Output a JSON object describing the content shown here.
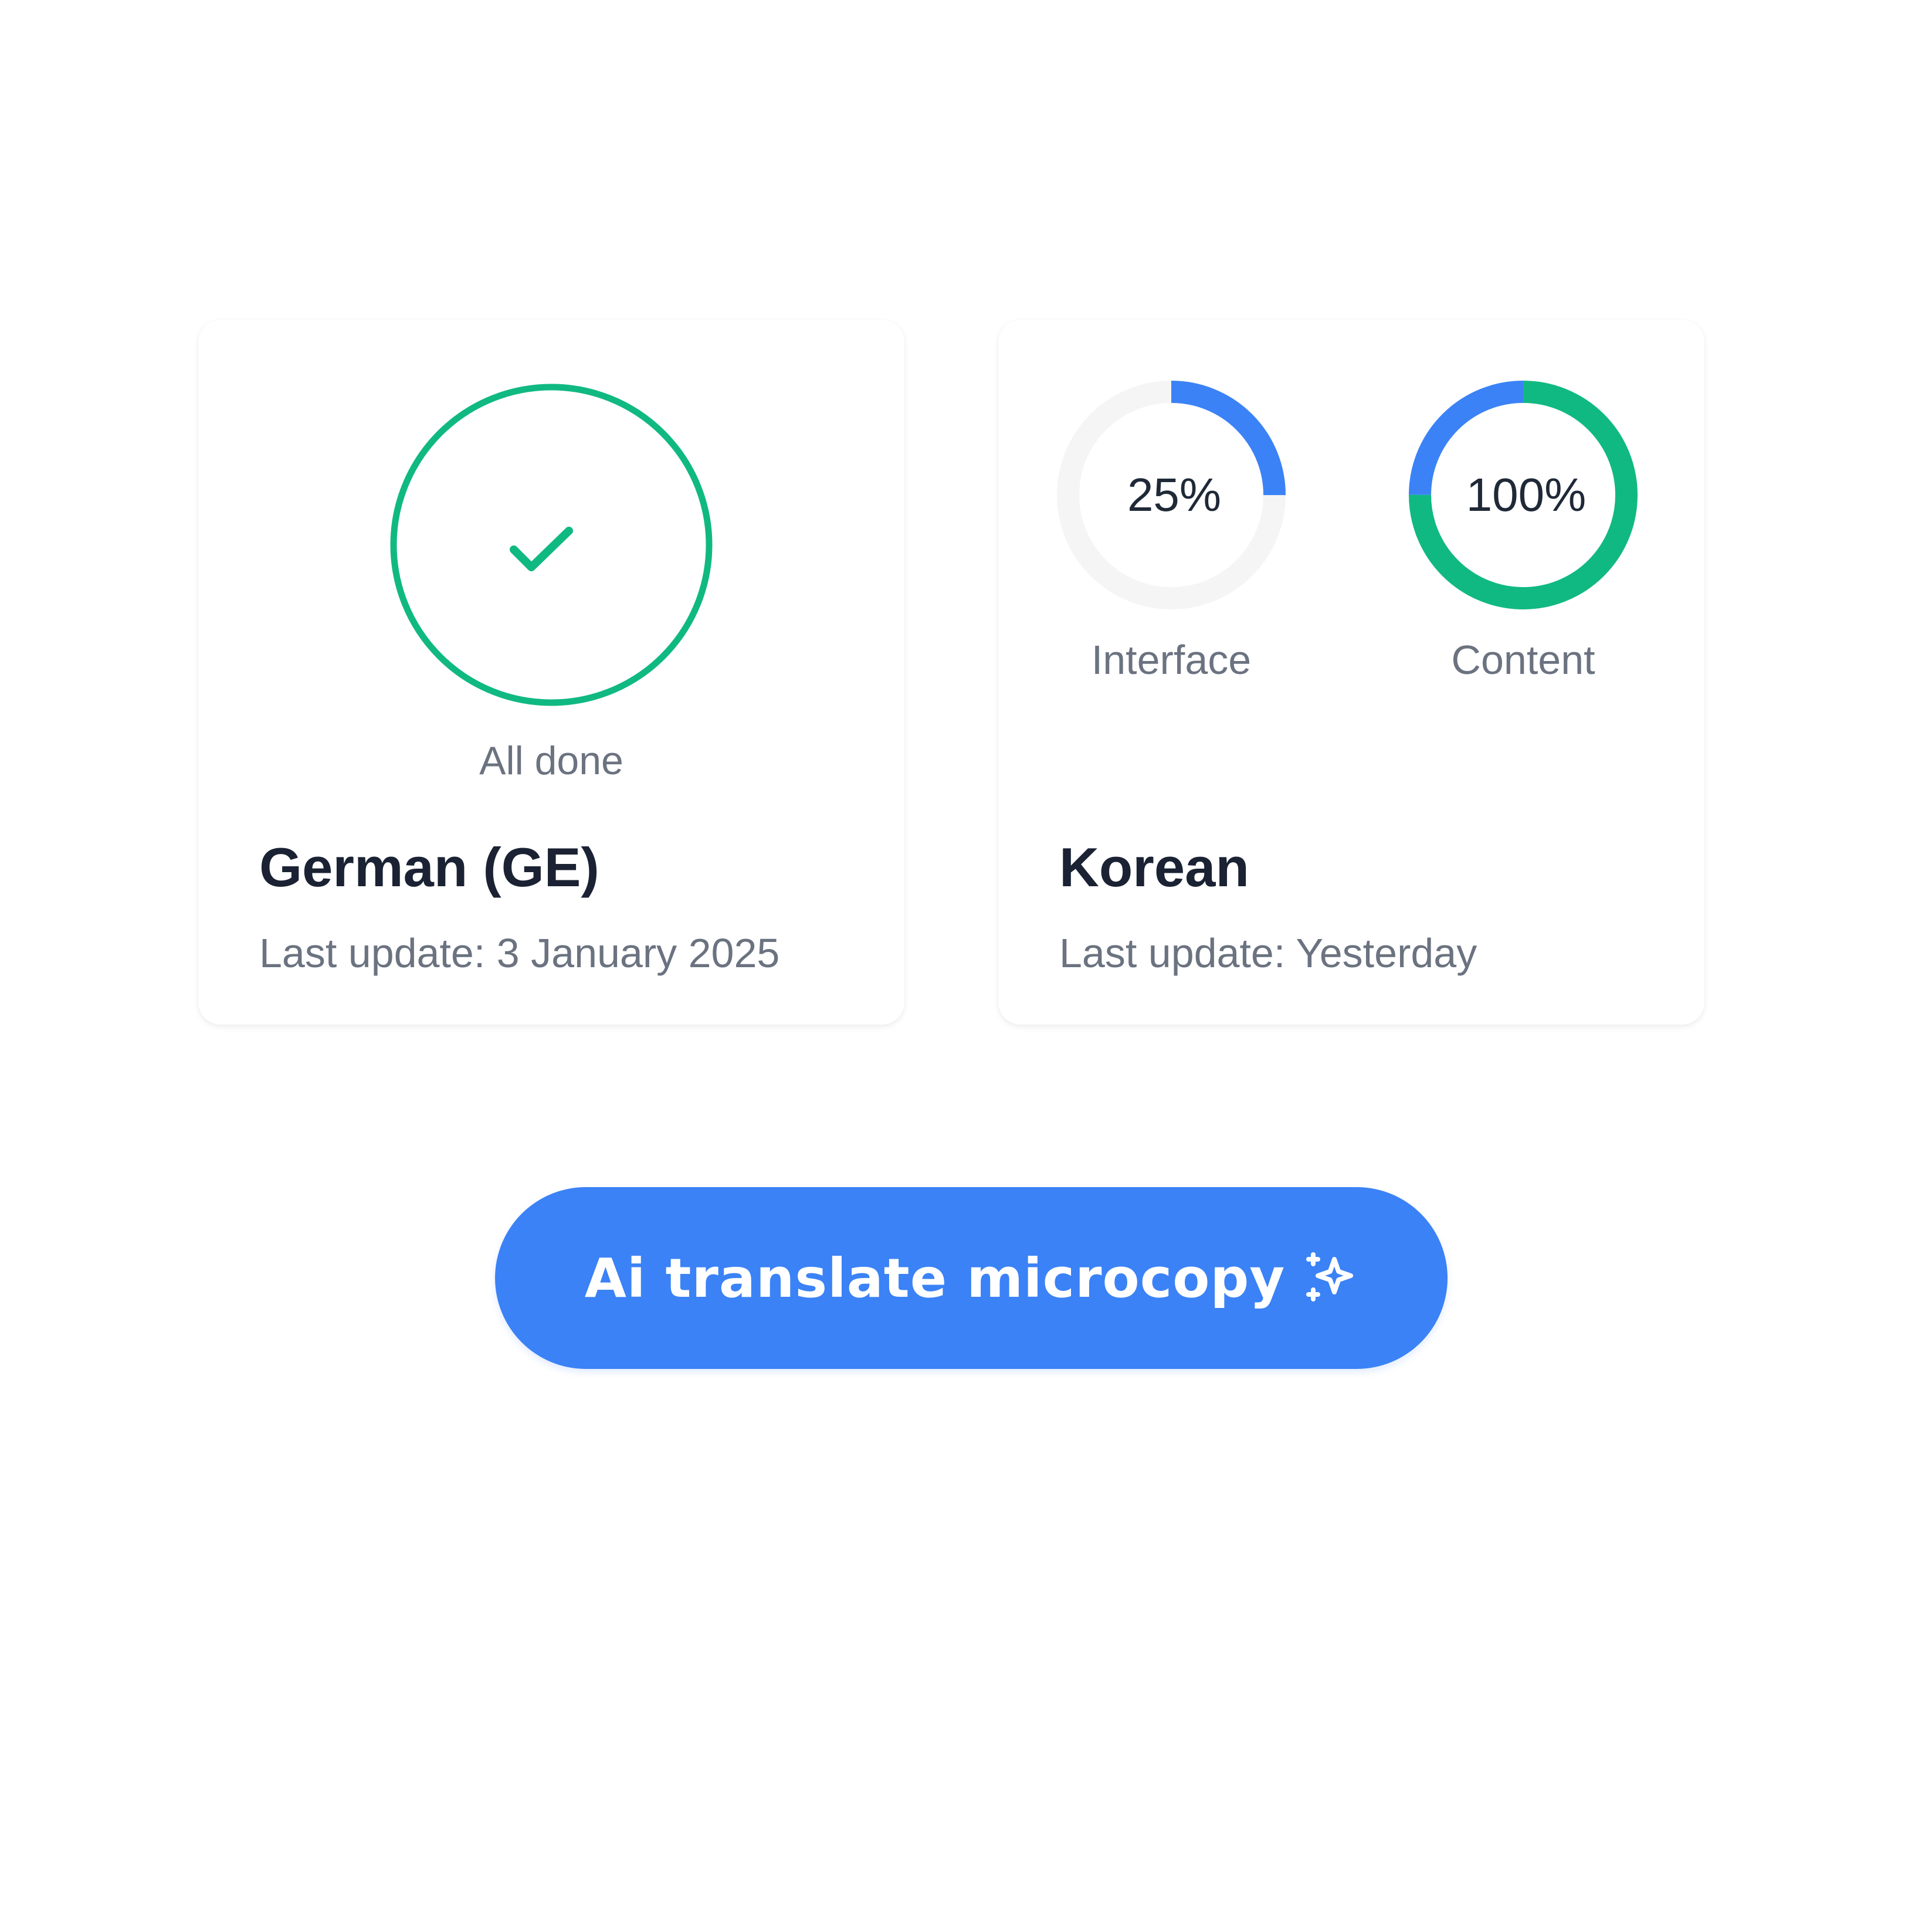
{
  "colors": {
    "success": "#10b981",
    "accent": "#3b82f6",
    "track": "#f5f5f5",
    "title": "#1a2233",
    "muted": "#6b7280"
  },
  "cards": {
    "german": {
      "status_icon": "check-circle-icon",
      "status_label": "All done",
      "title": "German (GE)",
      "last_update": "Last update: 3 January 2025"
    },
    "korean": {
      "title": "Korean",
      "last_update": "Last update: Yesterday",
      "progress": {
        "interface": {
          "value_text": "25%",
          "label": "Interface",
          "fraction": 0.25,
          "segment_color": "#3b82f6"
        },
        "content": {
          "value_text": "100%",
          "label": "Content",
          "segments": [
            {
              "fraction": 0.75,
              "color": "#10b981"
            },
            {
              "fraction": 0.25,
              "color": "#3b82f6"
            }
          ]
        }
      }
    }
  },
  "action": {
    "label": "Ai translate microcopy",
    "icon": "sparkle-icon"
  }
}
